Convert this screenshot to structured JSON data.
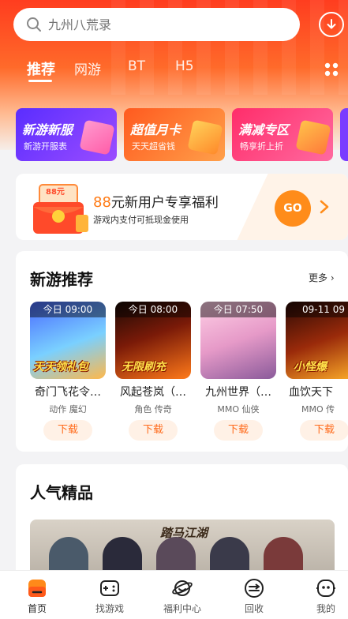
{
  "search": {
    "placeholder": "九州八荒录"
  },
  "tabs": [
    {
      "label": "推荐",
      "active": true
    },
    {
      "label": "网游"
    },
    {
      "label": "BT"
    },
    {
      "label": "H5"
    }
  ],
  "promos": [
    {
      "title": "新游新服",
      "subtitle": "新游开服表",
      "color": "#7a3cff"
    },
    {
      "title": "超值月卡",
      "subtitle": "天天超省钱",
      "color": "#ff7a2a"
    },
    {
      "title": "满减专区",
      "subtitle": "畅享折上折",
      "color": "#ff3d7a"
    }
  ],
  "welfare": {
    "amount": "88",
    "title_rest": "元新用户专享福利",
    "subtitle": "游戏内支付可抵现金使用",
    "packet_label": "88元",
    "go": "GO"
  },
  "new_games": {
    "title": "新游推荐",
    "more": "更多",
    "items": [
      {
        "time": "今日 09:00",
        "name": "奇门飞花令…",
        "tags": "动作 魔幻",
        "banner": "天天领礼包",
        "download": "下载"
      },
      {
        "time": "今日 08:00",
        "name": "风起苍岚（…",
        "tags": "角色 传奇",
        "banner": "无限刷充",
        "download": "下载"
      },
      {
        "time": "今日 07:50",
        "name": "九州世界（…",
        "tags": "MMO 仙侠",
        "banner": "",
        "download": "下载"
      },
      {
        "time": "09-11 09",
        "name": "血饮天下",
        "tags": "MMO 传",
        "banner": "小怪爆",
        "download": "下载"
      }
    ]
  },
  "popular": {
    "title": "人气精品",
    "feature_logo": "踏马江湖"
  },
  "tabbar": [
    {
      "label": "首页",
      "icon": "home-icon",
      "active": true
    },
    {
      "label": "找游戏",
      "icon": "gamepad-icon"
    },
    {
      "label": "福利中心",
      "icon": "planet-icon"
    },
    {
      "label": "回收",
      "icon": "recycle-icon"
    },
    {
      "label": "我的",
      "icon": "profile-icon"
    }
  ]
}
